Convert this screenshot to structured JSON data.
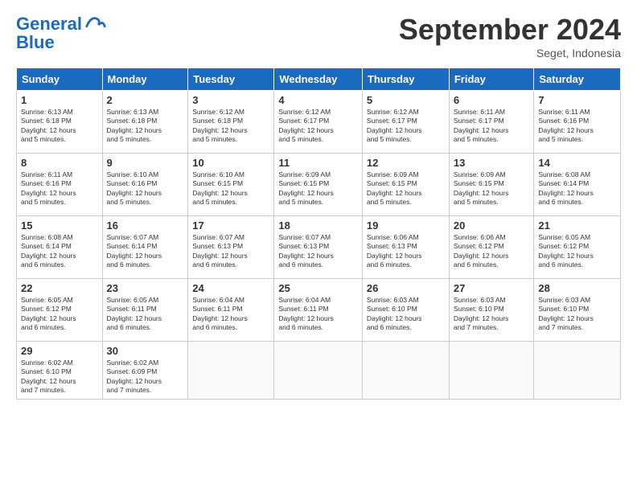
{
  "header": {
    "logo_general": "General",
    "logo_blue": "Blue",
    "month": "September 2024",
    "location": "Seget, Indonesia"
  },
  "weekdays": [
    "Sunday",
    "Monday",
    "Tuesday",
    "Wednesday",
    "Thursday",
    "Friday",
    "Saturday"
  ],
  "weeks": [
    [
      {
        "day": "1",
        "detail": "Sunrise: 6:13 AM\nSunset: 6:18 PM\nDaylight: 12 hours\nand 5 minutes."
      },
      {
        "day": "2",
        "detail": "Sunrise: 6:13 AM\nSunset: 6:18 PM\nDaylight: 12 hours\nand 5 minutes."
      },
      {
        "day": "3",
        "detail": "Sunrise: 6:12 AM\nSunset: 6:18 PM\nDaylight: 12 hours\nand 5 minutes."
      },
      {
        "day": "4",
        "detail": "Sunrise: 6:12 AM\nSunset: 6:17 PM\nDaylight: 12 hours\nand 5 minutes."
      },
      {
        "day": "5",
        "detail": "Sunrise: 6:12 AM\nSunset: 6:17 PM\nDaylight: 12 hours\nand 5 minutes."
      },
      {
        "day": "6",
        "detail": "Sunrise: 6:11 AM\nSunset: 6:17 PM\nDaylight: 12 hours\nand 5 minutes."
      },
      {
        "day": "7",
        "detail": "Sunrise: 6:11 AM\nSunset: 6:16 PM\nDaylight: 12 hours\nand 5 minutes."
      }
    ],
    [
      {
        "day": "8",
        "detail": "Sunrise: 6:11 AM\nSunset: 6:16 PM\nDaylight: 12 hours\nand 5 minutes."
      },
      {
        "day": "9",
        "detail": "Sunrise: 6:10 AM\nSunset: 6:16 PM\nDaylight: 12 hours\nand 5 minutes."
      },
      {
        "day": "10",
        "detail": "Sunrise: 6:10 AM\nSunset: 6:15 PM\nDaylight: 12 hours\nand 5 minutes."
      },
      {
        "day": "11",
        "detail": "Sunrise: 6:09 AM\nSunset: 6:15 PM\nDaylight: 12 hours\nand 5 minutes."
      },
      {
        "day": "12",
        "detail": "Sunrise: 6:09 AM\nSunset: 6:15 PM\nDaylight: 12 hours\nand 5 minutes."
      },
      {
        "day": "13",
        "detail": "Sunrise: 6:09 AM\nSunset: 6:15 PM\nDaylight: 12 hours\nand 5 minutes."
      },
      {
        "day": "14",
        "detail": "Sunrise: 6:08 AM\nSunset: 6:14 PM\nDaylight: 12 hours\nand 6 minutes."
      }
    ],
    [
      {
        "day": "15",
        "detail": "Sunrise: 6:08 AM\nSunset: 6:14 PM\nDaylight: 12 hours\nand 6 minutes."
      },
      {
        "day": "16",
        "detail": "Sunrise: 6:07 AM\nSunset: 6:14 PM\nDaylight: 12 hours\nand 6 minutes."
      },
      {
        "day": "17",
        "detail": "Sunrise: 6:07 AM\nSunset: 6:13 PM\nDaylight: 12 hours\nand 6 minutes."
      },
      {
        "day": "18",
        "detail": "Sunrise: 6:07 AM\nSunset: 6:13 PM\nDaylight: 12 hours\nand 6 minutes."
      },
      {
        "day": "19",
        "detail": "Sunrise: 6:06 AM\nSunset: 6:13 PM\nDaylight: 12 hours\nand 6 minutes."
      },
      {
        "day": "20",
        "detail": "Sunrise: 6:06 AM\nSunset: 6:12 PM\nDaylight: 12 hours\nand 6 minutes."
      },
      {
        "day": "21",
        "detail": "Sunrise: 6:05 AM\nSunset: 6:12 PM\nDaylight: 12 hours\nand 6 minutes."
      }
    ],
    [
      {
        "day": "22",
        "detail": "Sunrise: 6:05 AM\nSunset: 6:12 PM\nDaylight: 12 hours\nand 6 minutes."
      },
      {
        "day": "23",
        "detail": "Sunrise: 6:05 AM\nSunset: 6:11 PM\nDaylight: 12 hours\nand 6 minutes."
      },
      {
        "day": "24",
        "detail": "Sunrise: 6:04 AM\nSunset: 6:11 PM\nDaylight: 12 hours\nand 6 minutes."
      },
      {
        "day": "25",
        "detail": "Sunrise: 6:04 AM\nSunset: 6:11 PM\nDaylight: 12 hours\nand 6 minutes."
      },
      {
        "day": "26",
        "detail": "Sunrise: 6:03 AM\nSunset: 6:10 PM\nDaylight: 12 hours\nand 6 minutes."
      },
      {
        "day": "27",
        "detail": "Sunrise: 6:03 AM\nSunset: 6:10 PM\nDaylight: 12 hours\nand 7 minutes."
      },
      {
        "day": "28",
        "detail": "Sunrise: 6:03 AM\nSunset: 6:10 PM\nDaylight: 12 hours\nand 7 minutes."
      }
    ],
    [
      {
        "day": "29",
        "detail": "Sunrise: 6:02 AM\nSunset: 6:10 PM\nDaylight: 12 hours\nand 7 minutes."
      },
      {
        "day": "30",
        "detail": "Sunrise: 6:02 AM\nSunset: 6:09 PM\nDaylight: 12 hours\nand 7 minutes."
      },
      {
        "day": "",
        "detail": ""
      },
      {
        "day": "",
        "detail": ""
      },
      {
        "day": "",
        "detail": ""
      },
      {
        "day": "",
        "detail": ""
      },
      {
        "day": "",
        "detail": ""
      }
    ]
  ]
}
